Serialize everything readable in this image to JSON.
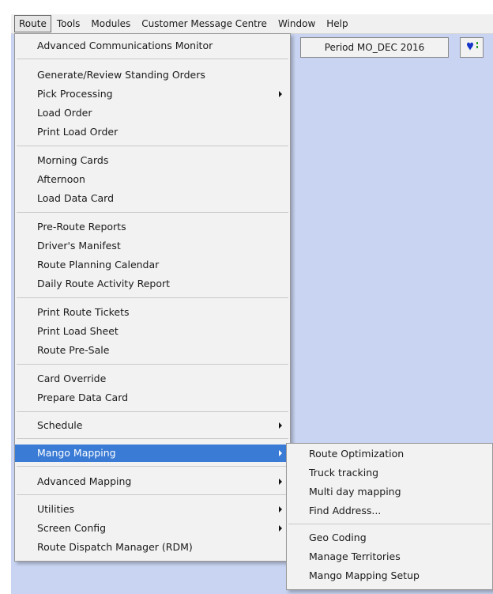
{
  "menubar": {
    "items": [
      "Route",
      "Tools",
      "Modules",
      "Customer Message Centre",
      "Window",
      "Help"
    ]
  },
  "toolbar": {
    "period_label": "Period MO_DEC  2016"
  },
  "route_menu": {
    "items": [
      "Advanced Communications Monitor",
      "Generate/Review Standing Orders",
      "Pick Processing",
      "Load Order",
      "Print Load Order",
      "Morning Cards",
      "Afternoon",
      "Load Data Card",
      "Pre-Route Reports",
      "Driver's Manifest",
      "Route Planning Calendar",
      "Daily Route Activity Report",
      "Print Route Tickets",
      "Print Load Sheet",
      "Route Pre-Sale",
      "Card Override",
      "Prepare Data Card",
      "Schedule",
      "Mango Mapping",
      "Advanced Mapping",
      "Utilities",
      "Screen Config",
      "Route Dispatch Manager (RDM)"
    ]
  },
  "mango_submenu": {
    "items": [
      "Route Optimization",
      "Truck tracking",
      "Multi day mapping",
      "Find Address...",
      "Geo Coding",
      "Manage Territories",
      "Mango Mapping Setup"
    ]
  },
  "colors": {
    "highlight": "#3a7bd5",
    "workspace": "#c8d4f2",
    "menu_bg": "#f2f2f2"
  }
}
